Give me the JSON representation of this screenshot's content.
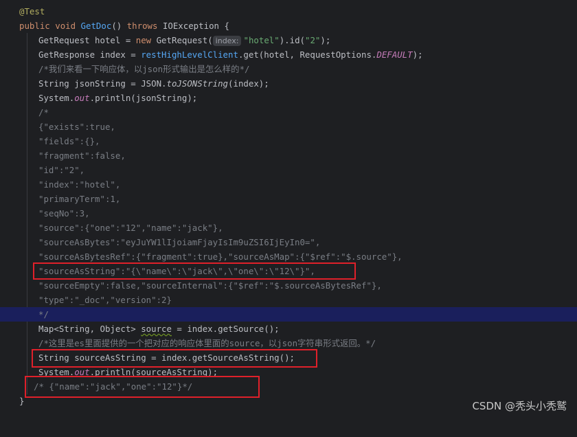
{
  "code": {
    "l1_annotation": "@Test",
    "l2_kw1": "public",
    "l2_kw2": "void",
    "l2_method": "GetDoc",
    "l2_rest": "() ",
    "l2_kw3": "throws",
    "l2_tail": " IOException {",
    "l3_a": "GetRequest hotel = ",
    "l3_new": "new",
    "l3_b": " GetRequest(",
    "l3_hint": "index:",
    "l3_str": "\"hotel\"",
    "l3_c": ").id(",
    "l3_str2": "\"2\"",
    "l3_d": ");",
    "l4_a": "GetResponse index = ",
    "l4_fn": "restHighLevelClient",
    "l4_b": ".get(hotel, RequestOptions.",
    "l4_fld": "DEFAULT",
    "l4_c": ");",
    "l5_comment": "/*我们来看一下响应体，以json形式输出是怎么样的*/",
    "l6_a": "String jsonString = JSON.",
    "l6_it": "toJSONString",
    "l6_b": "(index);",
    "l7_a": "System.",
    "l7_fld": "out",
    "l7_b": ".println(jsonString);",
    "l8": "/*",
    "l9": "{\"exists\":true,",
    "l10": "\"fields\":{},",
    "l11": "\"fragment\":false,",
    "l12": "\"id\":\"2\",",
    "l13": "\"index\":\"hotel\",",
    "l14": "\"primaryTerm\":1,",
    "l15": "\"seqNo\":3,",
    "l16": "\"source\":{\"one\":\"12\",\"name\":\"jack\"},",
    "l17": "\"sourceAsBytes\":\"eyJuYW1lIjoiamFjayIsIm9uZSI6IjEyIn0=\",",
    "l18": "\"sourceAsBytesRef\":{\"fragment\":true},\"sourceAsMap\":{\"$ref\":\"$.source\"},",
    "l19": "\"sourceAsString\":\"{\\\"name\\\":\\\"jack\\\",\\\"one\\\":\\\"12\\\"}\",",
    "l20": "\"sourceEmpty\":false,\"sourceInternal\":{\"$ref\":\"$.sourceAsBytesRef\"},",
    "l21": "\"type\":\"_doc\",\"version\":2}",
    "l22": "*/",
    "l23_a": "Map<String, Object> ",
    "l23_u": "source",
    "l23_b": " = index.getSource();",
    "l24_comment": "/*这里是es里面提供的一个把对应的响应体里面的source，以json字符串形式返回。*/",
    "l25": "String sourceAsString = index.getSourceAsString();",
    "l26_a": "System.",
    "l26_fld": "out",
    "l26_b": ".println(sourceAsString);",
    "l27_comment": "/* {\"name\":\"jack\",\"one\":\"12\"}*/",
    "l28": "}"
  },
  "watermark": "CSDN @秃头小秃鹫",
  "colors": {
    "background": "#1e1f22",
    "highlight_line": "#1a1f5c",
    "annotation_box": "#e0202a"
  }
}
